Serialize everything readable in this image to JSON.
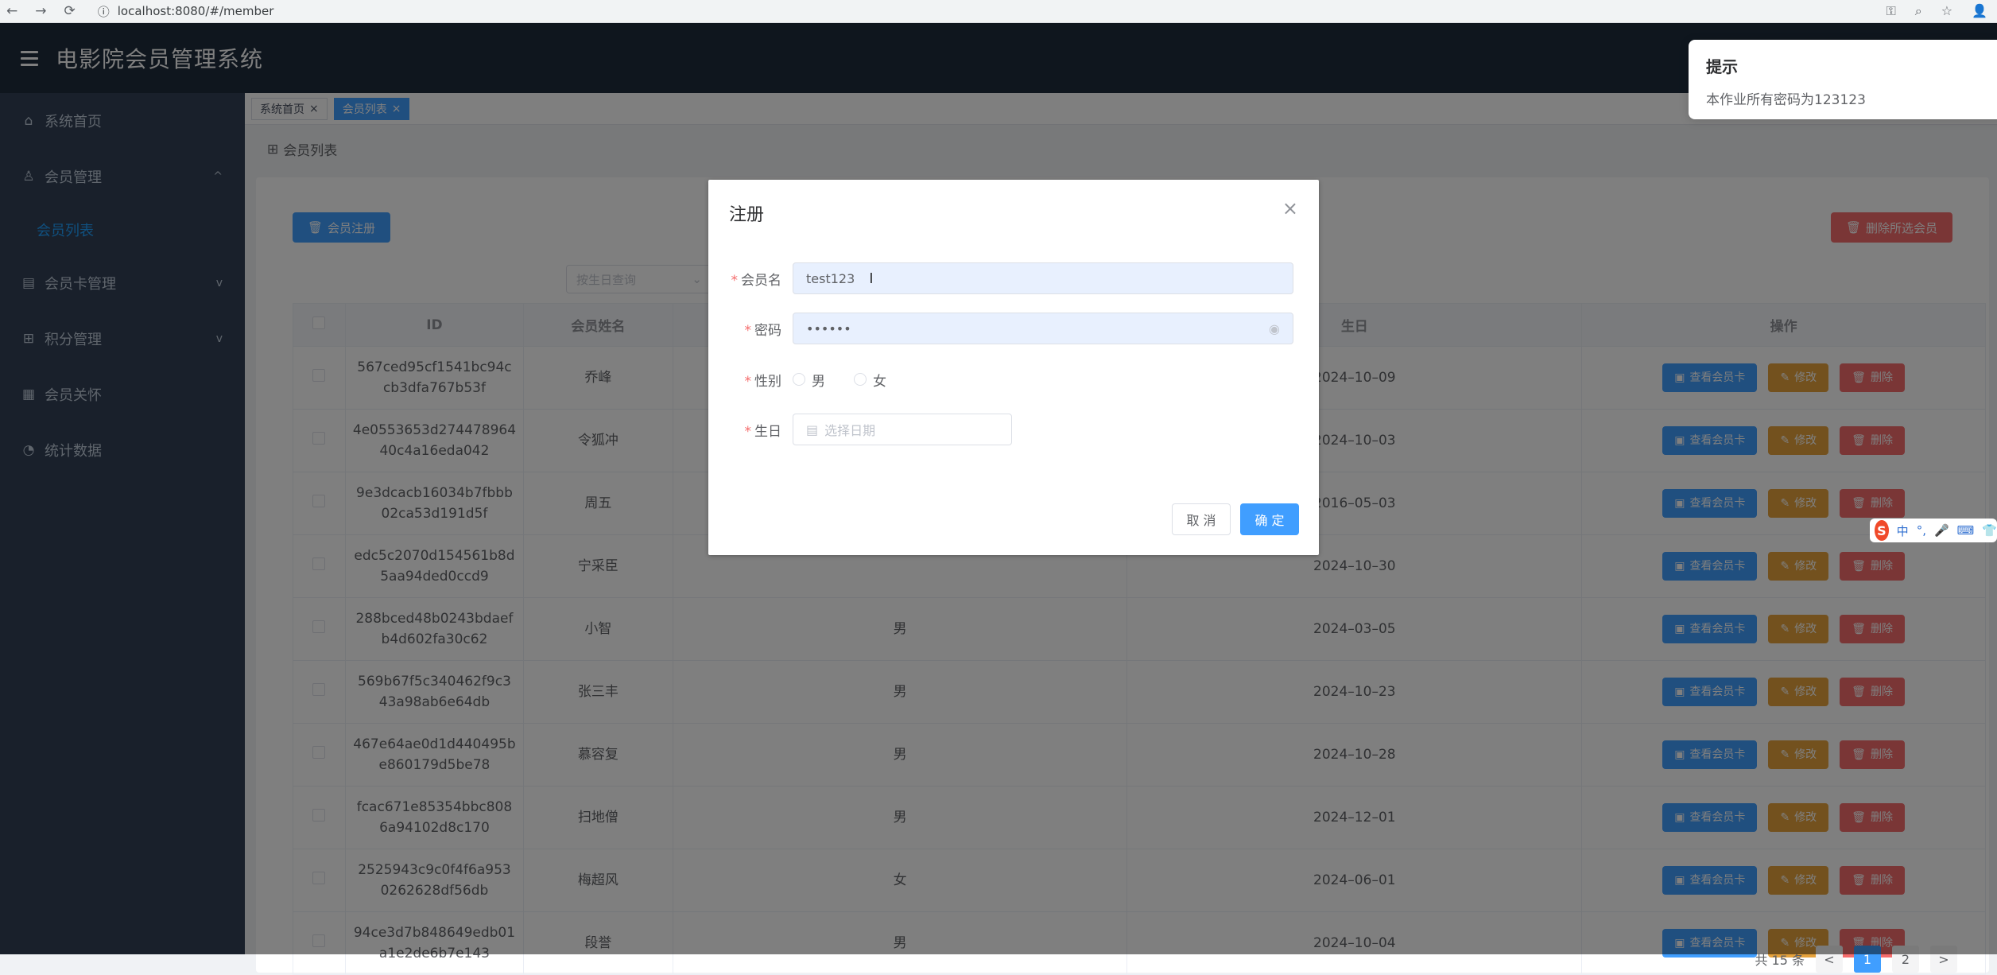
{
  "browser": {
    "url": "localhost:8080/#/member",
    "nav_back": "←",
    "nav_forward": "→",
    "nav_reload": "⟳",
    "info_icon": "ⓘ",
    "right_icons": [
      "⚿",
      "⌕",
      "☆",
      "👤"
    ]
  },
  "header": {
    "title": "电影院会员管理系统"
  },
  "sidebar": {
    "items": [
      {
        "label": "系统首页",
        "icon": "⌂"
      },
      {
        "label": "会员管理",
        "icon": "♙",
        "arrow": "^"
      },
      {
        "label": "会员列表",
        "sub": true
      },
      {
        "label": "会员卡管理",
        "icon": "▤",
        "arrow": "v"
      },
      {
        "label": "积分管理",
        "icon": "⊞",
        "arrow": "v"
      },
      {
        "label": "会员关怀",
        "icon": "▦"
      },
      {
        "label": "统计数据",
        "icon": "◔"
      }
    ]
  },
  "tags": [
    {
      "label": "系统首页",
      "close": "×"
    },
    {
      "label": "会员列表",
      "close": "×"
    }
  ],
  "breadcrumb": {
    "icon": "⊞",
    "label": "会员列表"
  },
  "toolbar": {
    "register_label": "会员注册",
    "delete_selected_label": "删除所选会员"
  },
  "filter": {
    "placeholder": "按生日查询"
  },
  "table": {
    "headers": [
      "ID",
      "会员姓名",
      "生日",
      "操作"
    ],
    "rows": [
      {
        "id": [
          "567ced95cf1541bc94c",
          "cb3dfa767b53f"
        ],
        "name": "乔峰",
        "gender": "",
        "birthday": "2024–10–09"
      },
      {
        "id": [
          "4e0553653d274478964",
          "40c4a16eda042"
        ],
        "name": "令狐冲",
        "gender": "",
        "birthday": "2024–10–03"
      },
      {
        "id": [
          "9e3dcacb16034b7fbbb",
          "02ca53d191d5f"
        ],
        "name": "周五",
        "gender": "",
        "birthday": "2016–05–03"
      },
      {
        "id": [
          "edc5c2070d154561b8d",
          "5aa94ded0ccd9"
        ],
        "name": "宁采臣",
        "gender": "",
        "birthday": "2024–10–30"
      },
      {
        "id": [
          "288bced48b0243bdaef",
          "b4d602fa30c62"
        ],
        "name": "小智",
        "gender": "男",
        "birthday": "2024–03–05"
      },
      {
        "id": [
          "569b67f5c340462f9c3",
          "43a98ab6e64db"
        ],
        "name": "张三丰",
        "gender": "男",
        "birthday": "2024–10–23"
      },
      {
        "id": [
          "467e64ae0d1d440495b",
          "e860179d5be78"
        ],
        "name": "慕容复",
        "gender": "男",
        "birthday": "2024–10–28"
      },
      {
        "id": [
          "fcac671e85354bbc808",
          "6a94102d8c170"
        ],
        "name": "扫地僧",
        "gender": "男",
        "birthday": "2024–12–01"
      },
      {
        "id": [
          "2525943c9c0f4f6a953",
          "0262628df56db"
        ],
        "name": "梅超风",
        "gender": "女",
        "birthday": "2024–06–01"
      },
      {
        "id": [
          "94ce3d7b848649edb01",
          "a1e2de6b7e143"
        ],
        "name": "段誉",
        "gender": "男",
        "birthday": "2024–10–04"
      }
    ],
    "ops": {
      "view_card": "查看会员卡",
      "edit": "修改",
      "delete": "删除"
    }
  },
  "pagination": {
    "total": "共 15 条",
    "pages": [
      "1",
      "2"
    ],
    "prev": "<",
    "next": ">"
  },
  "dialog": {
    "title": "注册",
    "close": "×",
    "fields": {
      "username_label": "会员名",
      "username_value": "test123",
      "password_label": "密码",
      "password_value": "••••••",
      "gender_label": "性别",
      "gender_options": [
        "男",
        "女"
      ],
      "birthday_label": "生日",
      "birthday_placeholder": "选择日期",
      "required_mark": "*"
    },
    "cancel_label": "取 消",
    "confirm_label": "确 定"
  },
  "notification": {
    "title": "提示",
    "message": "本作业所有密码为123123",
    "close": "×"
  },
  "ime": {
    "logo": "S",
    "labels": [
      "中",
      "°,",
      "🎤",
      "⌨",
      "👕"
    ]
  },
  "colors": {
    "primary": "#409eff",
    "danger": "#f56c6c",
    "warning": "#e6a23c",
    "sidebar": "#324157",
    "header": "#1f2d3d"
  }
}
